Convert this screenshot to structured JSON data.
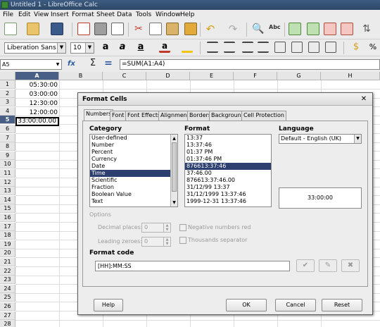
{
  "window": {
    "title": "Untitled 1 - LibreOffice Calc"
  },
  "menu": [
    "File",
    "Edit",
    "View",
    "Insert",
    "Format",
    "Sheet",
    "Data",
    "Tools",
    "Window",
    "Help"
  ],
  "toolbar": {
    "font_name": "Liberation Sans",
    "font_size": "10",
    "font_color": "#c0392b",
    "highlight_color": "#f1c40f"
  },
  "formula": {
    "namebox": "A5",
    "fx": "fx",
    "sum": "Σ",
    "equals": "=",
    "content": "=SUM(A1:A4)"
  },
  "sheet": {
    "columns": [
      "A",
      "B",
      "C",
      "D",
      "E",
      "F",
      "G",
      "H"
    ],
    "rows": [
      "1",
      "2",
      "3",
      "4",
      "5",
      "6",
      "7",
      "8",
      "9",
      "10",
      "11",
      "12",
      "13",
      "14",
      "15",
      "16",
      "17",
      "18",
      "19",
      "20",
      "21",
      "22",
      "23",
      "24",
      "25",
      "26",
      "27",
      "28"
    ],
    "values": [
      "05:30:00",
      "03:00:00",
      "12:30:00",
      "12:00:00",
      "33:00:00.00"
    ],
    "active_cell": "A5"
  },
  "dialog": {
    "title": "Format Cells",
    "close": "✕",
    "tabs": [
      "Numbers",
      "Font",
      "Font Effects",
      "Alignment",
      "Borders",
      "Background",
      "Cell Protection"
    ],
    "category_label": "Category",
    "categories": [
      "User-defined",
      "Number",
      "Percent",
      "Currency",
      "Date",
      "Time",
      "Scientific",
      "Fraction",
      "Boolean Value",
      "Text"
    ],
    "selected_category": "Time",
    "format_label": "Format",
    "formats": [
      "13:37",
      "13:37:46",
      "01:37 PM",
      "01:37:46 PM",
      "876613:37:46",
      "37:46.00",
      "876613:37:46.00",
      "31/12/99 13:37",
      "31/12/1999 13:37:46",
      "1999-12-31 13:37:46"
    ],
    "selected_format": "876613:37:46",
    "language_label": "Language",
    "language_value": "Default - English (UK)",
    "preview_value": "33:00:00",
    "options_label": "Options",
    "decimal_label": "Decimal places:",
    "decimal_value": "0",
    "leading_label": "Leading zeroes:",
    "leading_value": "0",
    "negative_label": "Negative numbers red",
    "thousands_label": "Thousands separator",
    "format_code_label": "Format code",
    "format_code_value": "[HH]:MM:SS",
    "buttons": {
      "help": "Help",
      "ok": "OK",
      "cancel": "Cancel",
      "reset": "Reset"
    }
  }
}
